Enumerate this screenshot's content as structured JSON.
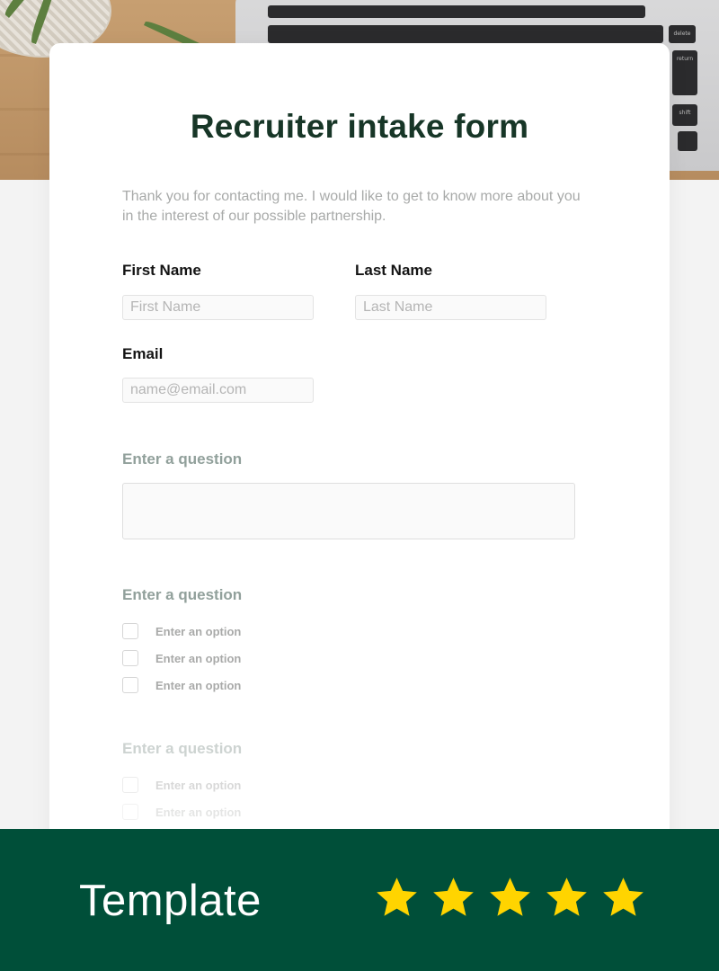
{
  "form": {
    "title": "Recruiter intake form",
    "intro": "Thank you for contacting me. I would like to get to know more about you in the interest of our possible partnership.",
    "first_name": {
      "label": "First Name",
      "placeholder": "First Name"
    },
    "last_name": {
      "label": "Last Name",
      "placeholder": "Last Name"
    },
    "email": {
      "label": "Email",
      "placeholder": "name@email.com"
    },
    "questions": [
      {
        "label": "Enter a question"
      },
      {
        "label": "Enter a question",
        "options": [
          "Enter an option",
          "Enter an option",
          "Enter an option"
        ]
      },
      {
        "label": "Enter a question",
        "options": [
          "Enter an option",
          "Enter an option"
        ]
      }
    ]
  },
  "footer": {
    "label": "Template",
    "rating": 5
  },
  "colors": {
    "title": "#173627",
    "footer_bg": "#004f39",
    "star": "#ffd400",
    "question_label": "#91a09b"
  },
  "photo": {
    "keys": [
      "delete",
      "return",
      "shift"
    ]
  }
}
